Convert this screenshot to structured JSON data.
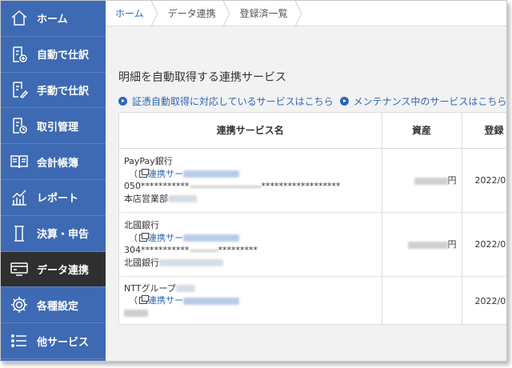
{
  "sidebar": {
    "items": [
      {
        "label": "ホーム",
        "icon": "home-icon"
      },
      {
        "label": "自動で仕訳",
        "icon": "auto-journal-icon"
      },
      {
        "label": "手動で仕訳",
        "icon": "manual-journal-icon"
      },
      {
        "label": "取引管理",
        "icon": "transaction-icon"
      },
      {
        "label": "会計帳簿",
        "icon": "ledger-book-icon"
      },
      {
        "label": "レポート",
        "icon": "report-chart-icon"
      },
      {
        "label": "決算・申告",
        "icon": "settlement-icon"
      },
      {
        "label": "データ連携",
        "icon": "data-link-icon"
      },
      {
        "label": "各種設定",
        "icon": "gear-icon"
      },
      {
        "label": "他サービス",
        "icon": "list-icon"
      }
    ],
    "active_index": 7,
    "colors": {
      "background": "#3d6ab2",
      "active": "#2f2f2f"
    }
  },
  "breadcrumb": [
    "ホーム",
    "データ連携",
    "登録済一覧"
  ],
  "main": {
    "section_title": "明細を自動取得する連携サービス",
    "links": [
      "証憑自動取得に対応しているサービスはこちら",
      "メンテナンス中のサービスはこちら"
    ]
  },
  "table": {
    "columns": [
      "連携サービス名",
      "資産",
      "登録"
    ],
    "rows": [
      {
        "bank": "PayPay銀行",
        "link_text": "連携サー",
        "account": "050***********",
        "account_tail": "******************",
        "branch": "本店営業部",
        "asset_suffix": "円",
        "date": "2022/0"
      },
      {
        "bank": "北國銀行",
        "link_text": "連携サー",
        "account": "304***********",
        "account_tail": "*********",
        "branch": "北國銀行",
        "asset_suffix": "円",
        "date": "2022/0"
      },
      {
        "bank": "NTTグループ",
        "link_text": "連携サー",
        "account": "",
        "account_tail": "",
        "branch": "",
        "asset_suffix": "",
        "date": "2022/0"
      }
    ]
  }
}
